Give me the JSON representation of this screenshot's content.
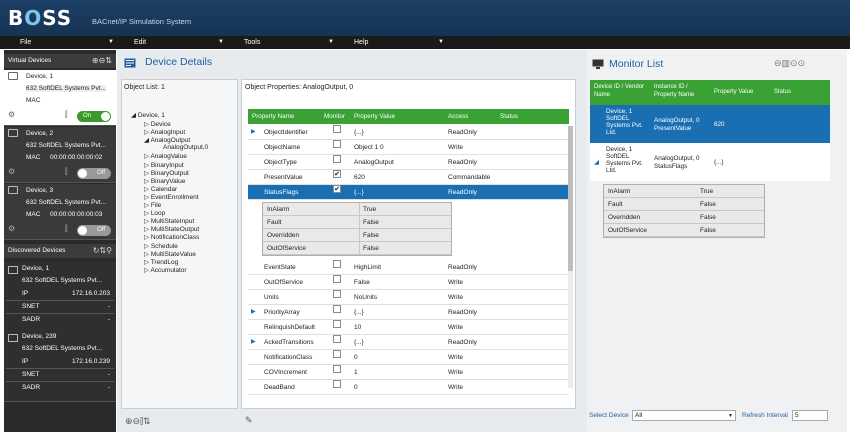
{
  "app": {
    "logo_b": "B",
    "logo_o": "O",
    "logo_ss": "SS",
    "subtitle": "BACnet/IP Simulation System"
  },
  "menu": [
    {
      "label": "File"
    },
    {
      "label": "Edit"
    },
    {
      "label": "Tools"
    },
    {
      "label": "Help"
    }
  ],
  "virtual_devices": {
    "title": "Virtual Devices",
    "items": [
      {
        "name": "Device, 1",
        "vendor": "632 SoftDEL Systems Pvt...",
        "mac_label": "MAC",
        "mac": "",
        "toggle": "On"
      },
      {
        "name": "Device, 2",
        "vendor": "632 SoftDEL Systems Pvt...",
        "mac_label": "MAC",
        "mac": "00:00:00:00:00:02",
        "toggle": "Off"
      },
      {
        "name": "Device, 3",
        "vendor": "632 SoftDEL Systems Pvt...",
        "mac_label": "MAC",
        "mac": "00:00:00:00:00:03",
        "toggle": "Off"
      }
    ]
  },
  "discovered_devices": {
    "title": "Discovered Devices",
    "items": [
      {
        "name": "Device, 1",
        "vendor": "632 SoftDEL Systems Pvt...",
        "ip_label": "IP",
        "ip": "172.16.0.203",
        "snet_label": "SNET",
        "snet": "-",
        "sadr_label": "SADR",
        "sadr": "-"
      },
      {
        "name": "Device, 239",
        "vendor": "632 SoftDEL Systems Pvt...",
        "ip_label": "IP",
        "ip": "172.16.0.239",
        "snet_label": "SNET",
        "snet": "-",
        "sadr_label": "SADR",
        "sadr": "-"
      }
    ]
  },
  "device_details": {
    "title": "Device Details",
    "object_list_label": "Object List: 1",
    "object_props_label": "Object Properties: AnalogOutput, 0"
  },
  "tree": {
    "root": "Device, 1",
    "children": [
      "Device",
      "AnalogInput",
      "AnalogOutput",
      "AnalogOutput,0",
      "AnalogValue",
      "BinaryInput",
      "BinaryOutput",
      "BinaryValue",
      "Calendar",
      "EventEnrollment",
      "File",
      "Loop",
      "MultiStateInput",
      "MultiStateOutput",
      "NotificationClass",
      "Schedule",
      "MultiStateValue",
      "TrendLog",
      "Accumulator"
    ]
  },
  "props": {
    "headers": [
      "Property Name",
      "Monitor",
      "Property Value",
      "Access",
      "Status"
    ],
    "rows": [
      {
        "name": "ObjectIdentifier",
        "value": "{...}",
        "access": "ReadOnly",
        "checked": false,
        "exp": true
      },
      {
        "name": "ObjectName",
        "value": "Object 1 0",
        "access": "Write",
        "checked": false,
        "exp": false
      },
      {
        "name": "ObjectType",
        "value": "AnalogOutput",
        "access": "ReadOnly",
        "checked": false,
        "exp": false
      },
      {
        "name": "PresentValue",
        "value": "620",
        "access": "Commandable",
        "checked": true,
        "exp": false
      },
      {
        "name": "StatusFlags",
        "value": "{...}",
        "access": "ReadOnly",
        "checked": true,
        "exp": true
      },
      {
        "name": "EventState",
        "value": "HighLimit",
        "access": "ReadOnly",
        "checked": false,
        "exp": false
      },
      {
        "name": "OutOfService",
        "value": "False",
        "access": "Write",
        "checked": false,
        "exp": false
      },
      {
        "name": "Units",
        "value": "NoUnits",
        "access": "Write",
        "checked": false,
        "exp": false
      },
      {
        "name": "PriorityArray",
        "value": "{...}",
        "access": "ReadOnly",
        "checked": false,
        "exp": true
      },
      {
        "name": "RelinquishDefault",
        "value": "10",
        "access": "Write",
        "checked": false,
        "exp": false
      },
      {
        "name": "AckedTransitions",
        "value": "{...}",
        "access": "ReadOnly",
        "checked": false,
        "exp": true
      },
      {
        "name": "NotificationClass",
        "value": "0",
        "access": "Write",
        "checked": false,
        "exp": false
      },
      {
        "name": "COVIncrement",
        "value": "1",
        "access": "Write",
        "checked": false,
        "exp": false
      },
      {
        "name": "DeadBand",
        "value": "0",
        "access": "Write",
        "checked": false,
        "exp": false
      }
    ],
    "flags": [
      {
        "k": "InAlarm",
        "v": "True"
      },
      {
        "k": "Fault",
        "v": "False"
      },
      {
        "k": "Overridden",
        "v": "False"
      },
      {
        "k": "OutOfService",
        "v": "False"
      }
    ]
  },
  "monitor": {
    "title": "Monitor List",
    "headers": [
      "Device ID / Vendor Name",
      "Instance ID / Property Name",
      "Property Value",
      "Status"
    ],
    "rows": [
      {
        "dev": [
          "Device, 1",
          "SoftDEL",
          "Systems Pvt.",
          "Ltd."
        ],
        "inst": [
          "AnalogOutput, 0",
          "PresentValue"
        ],
        "val": "620"
      },
      {
        "dev": [
          "Device, 1",
          "SoftDEL",
          "Systems Pvt.",
          "Ltd."
        ],
        "inst": [
          "AnalogOutput, 0",
          "StatusFlags"
        ],
        "val": "{...}"
      }
    ],
    "flags": [
      {
        "k": "InAlarm",
        "v": "True"
      },
      {
        "k": "Fault",
        "v": "False"
      },
      {
        "k": "Overridden",
        "v": "False"
      },
      {
        "k": "OutOfService",
        "v": "False"
      }
    ],
    "select_label": "Select Device",
    "select_value": "All",
    "refresh_label": "Refresh Interval",
    "refresh_value": "5"
  },
  "colors": {
    "header": "#1c3f66",
    "accent_green": "#3aa134",
    "select_blue": "#1a6fb3"
  }
}
